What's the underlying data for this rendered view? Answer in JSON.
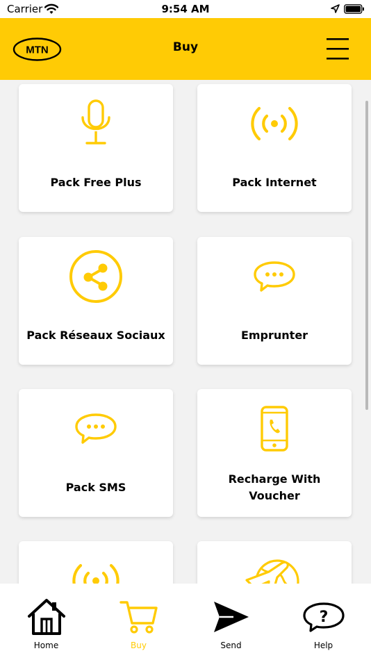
{
  "status_bar": {
    "carrier": "Carrier",
    "time": "9:54 AM"
  },
  "header": {
    "logo_text": "MTN",
    "title": "Buy",
    "menu_icon": "hamburger-menu-icon"
  },
  "cards": [
    {
      "label": "Pack Free Plus",
      "icon": "microphone-icon"
    },
    {
      "label": "Pack Internet",
      "icon": "broadcast-icon"
    },
    {
      "label": "Pack Réseaux Sociaux",
      "icon": "share-icon"
    },
    {
      "label": "Emprunter",
      "icon": "chat-bubble-icon"
    },
    {
      "label": "Pack SMS",
      "icon": "chat-bubble-icon"
    },
    {
      "label_line1": "Recharge With",
      "label_line2": "Voucher",
      "icon": "phone-call-icon"
    },
    {
      "label": "",
      "icon": "broadcast-icon"
    },
    {
      "label": "",
      "icon": "travel-globe-icon"
    }
  ],
  "tabs": [
    {
      "label": "Home",
      "icon": "home-icon",
      "active": false
    },
    {
      "label": "Buy",
      "icon": "cart-icon",
      "active": true
    },
    {
      "label": "Send",
      "icon": "send-icon",
      "active": false
    },
    {
      "label": "Help",
      "icon": "help-icon",
      "active": false
    }
  ],
  "colors": {
    "brand_yellow": "#ffcb05",
    "black": "#000000",
    "white": "#ffffff",
    "background": "#f2f2f2"
  }
}
